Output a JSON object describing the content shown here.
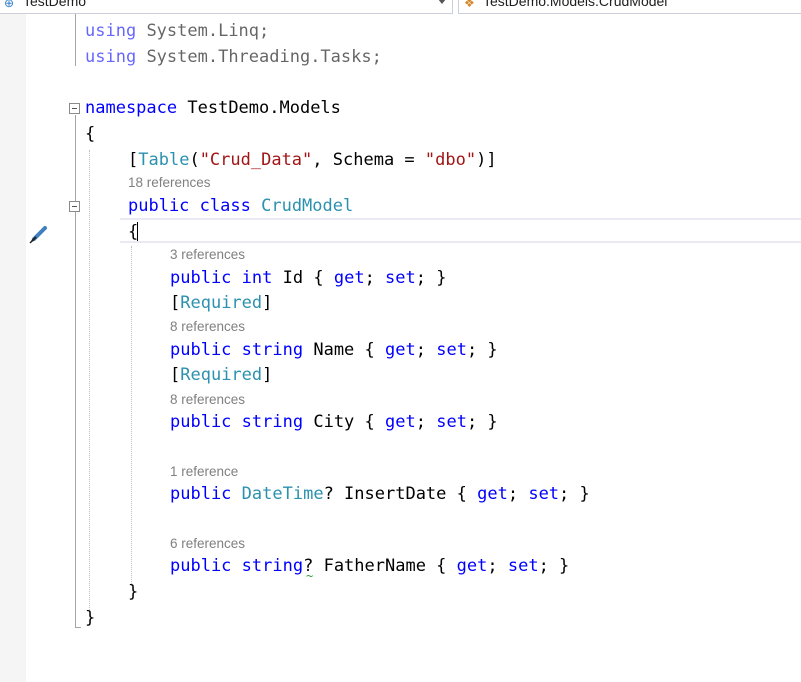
{
  "navbar": {
    "project_dropdown": "TestDemo",
    "type_dropdown": "TestDemo.Models.CrudModel"
  },
  "code": {
    "using_linq": "System.Linq;",
    "using_tasks": "System.Threading.Tasks;",
    "kw_using": "using",
    "kw_namespace": "namespace",
    "namespace_name": "TestDemo.Models",
    "open_brace": "{",
    "close_brace": "}",
    "attr_table": "Table",
    "attr_arg1": "\"Crud_Data\"",
    "attr_schema": "Schema",
    "attr_arg2": "\"dbo\"",
    "lens_class": "18 references",
    "kw_public": "public",
    "kw_class": "class",
    "class_name": "CrudModel",
    "lens_id": "3 references",
    "kw_int": "int",
    "prop_id": "Id",
    "kw_get": "get",
    "kw_set": "set",
    "attr_required": "Required",
    "lens_name": "8 references",
    "kw_string": "string",
    "prop_name": "Name",
    "lens_city": "8 references",
    "prop_city": "City",
    "lens_insert": "1 reference",
    "type_datetime": "DateTime",
    "prop_insert": "InsertDate",
    "lens_father": "6 references",
    "prop_father": "FatherName"
  },
  "icons": [
    "paintbrush-icon",
    "collapse-icon",
    "dropdown-arrow-icon",
    "csharp-project-icon",
    "class-icon"
  ]
}
